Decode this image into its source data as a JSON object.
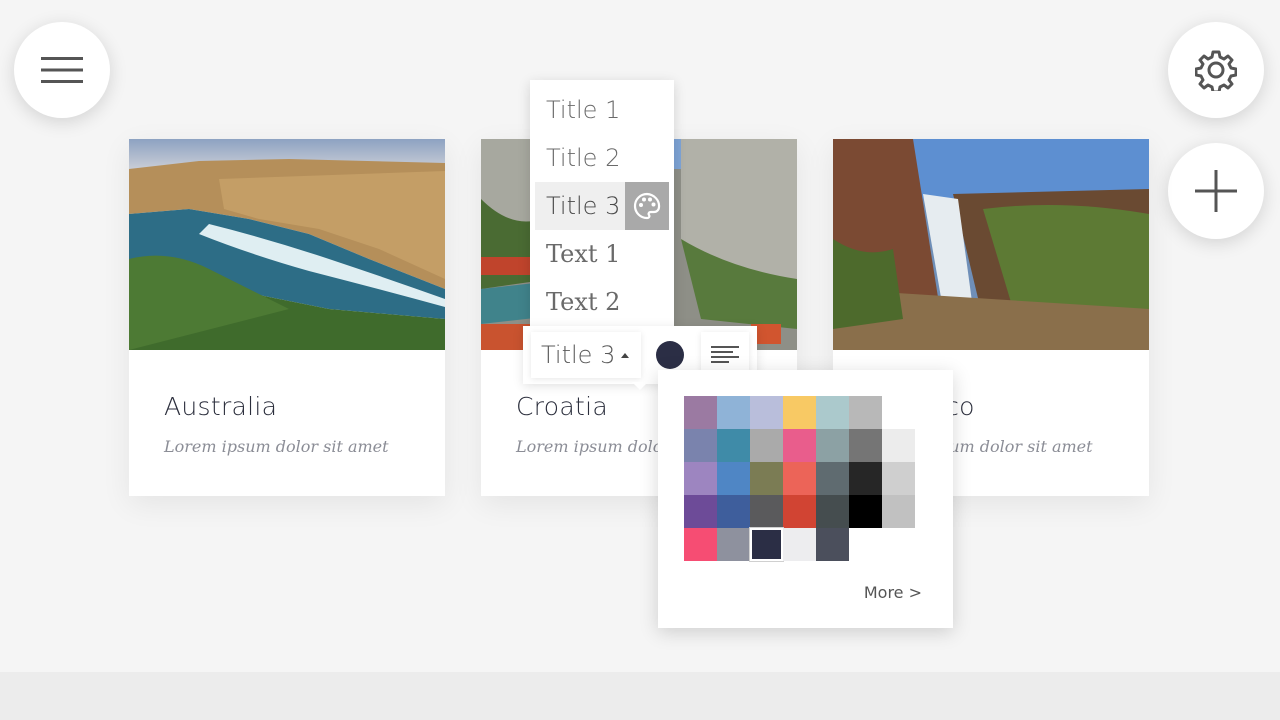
{
  "toolbar_fabs": {
    "menu_icon": "hamburger-menu-icon",
    "settings_icon": "gear-icon",
    "add_icon": "plus-icon"
  },
  "cards": [
    {
      "title": "Australia",
      "subtitle": "Lorem ipsum dolor sit amet"
    },
    {
      "title": "Croatia",
      "subtitle": "Lorem ipsum dolor sit amet"
    },
    {
      "title": "Morocco",
      "subtitle": "Lorem ipsum dolor sit amet"
    }
  ],
  "style_menu": {
    "items": [
      {
        "label": "Title 1"
      },
      {
        "label": "Title 2"
      },
      {
        "label": "Title 3"
      },
      {
        "label": "Text 1"
      },
      {
        "label": "Text 2"
      }
    ],
    "active_index": 2,
    "palette_icon": "palette-icon"
  },
  "text_toolbar": {
    "style_label": "Title 3",
    "current_color": "#2b2e45",
    "align_icon": "align-left-icon"
  },
  "color_popup": {
    "swatches": [
      [
        "#9b7aa2",
        "#8fb3d7",
        "#b9bedb",
        "#f8c964",
        "#abc9cc",
        "#b8b8b8",
        null
      ],
      [
        "#7a83ad",
        "#3f8ba8",
        "#aaaaaa",
        "#e95d8c",
        "#8ca1a4",
        "#757575",
        "#ececec"
      ],
      [
        "#9d85c0",
        "#4f86c5",
        "#7b7c54",
        "#ec6458",
        "#5f6b70",
        "#262626",
        "#cfcfcf"
      ],
      [
        "#6d4b98",
        "#3e5e9c",
        "#5a5a5c",
        "#d14433",
        "#454d4f",
        "#000000",
        "#c1c1c1"
      ],
      [
        "#f64d73",
        "#8e919e",
        "#2b2e45",
        "#ededef",
        "#4b4f5c",
        null,
        null
      ]
    ],
    "selected": "#2b2e45",
    "more_label": "More >"
  }
}
